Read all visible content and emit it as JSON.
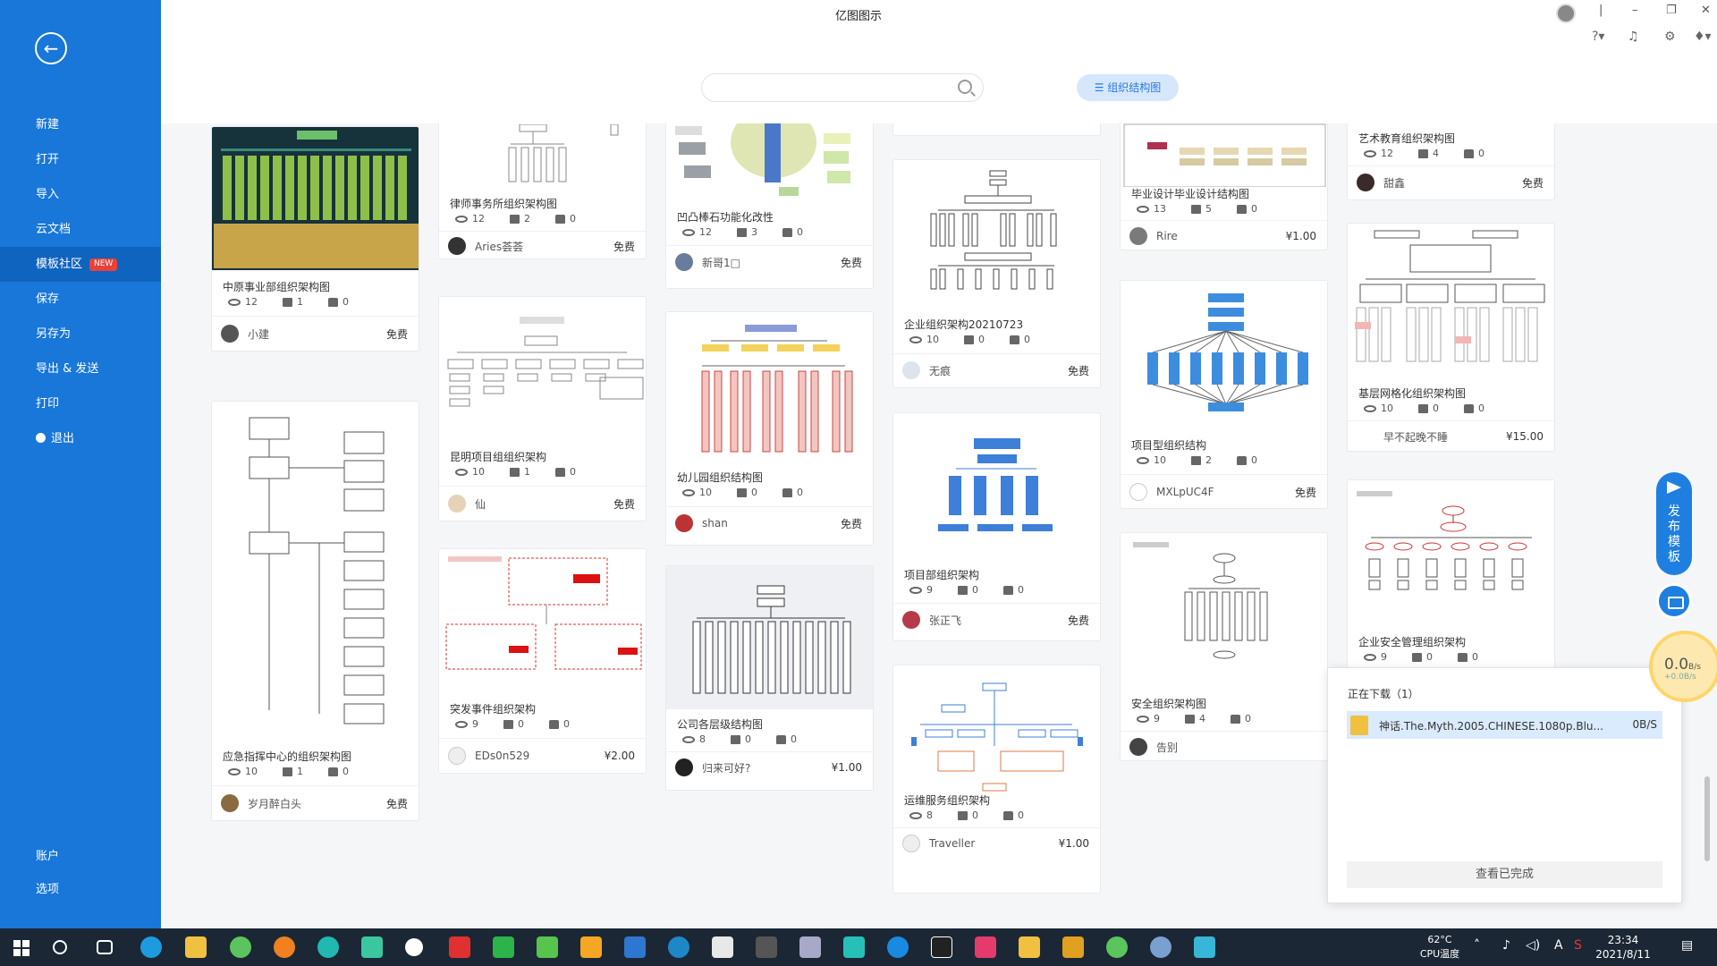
{
  "app": {
    "title": "亿图图示"
  },
  "sidebar": {
    "items": [
      {
        "label": "新建"
      },
      {
        "label": "打开"
      },
      {
        "label": "导入"
      },
      {
        "label": "云文档"
      },
      {
        "label": "模板社区",
        "badge": "NEW",
        "active": true
      },
      {
        "label": "保存"
      },
      {
        "label": "另存为"
      },
      {
        "label": "导出 & 发送"
      },
      {
        "label": "打印"
      },
      {
        "label": "退出"
      }
    ],
    "bottom": [
      {
        "label": "账户"
      },
      {
        "label": "选项"
      }
    ]
  },
  "search": {
    "placeholder": "",
    "filter_label": "☰ 组织结构图"
  },
  "cards": [
    {
      "title": "中原事业部组织架构图",
      "views": "12",
      "comments": "1",
      "likes": "0",
      "author": "小建",
      "price": "免费"
    },
    {
      "title": "应急指挥中心的组织架构图",
      "views": "10",
      "comments": "1",
      "likes": "0",
      "author": "岁月醉白头",
      "price": "免费"
    },
    {
      "title": "律师事务所组织架构图",
      "views": "12",
      "comments": "2",
      "likes": "0",
      "author": "Aries荟荟",
      "price": "免费"
    },
    {
      "title": "昆明项目组组织架构",
      "views": "10",
      "comments": "1",
      "likes": "0",
      "author": "仙",
      "price": "免费"
    },
    {
      "title": "突发事件组织架构",
      "views": "9",
      "comments": "0",
      "likes": "0",
      "author": "EDs0n529",
      "price": "¥2.00"
    },
    {
      "title": "凹凸棒石功能化改性",
      "views": "12",
      "comments": "3",
      "likes": "0",
      "author": "新哥1□",
      "price": "免费"
    },
    {
      "title": "幼儿园组织结构图",
      "views": "10",
      "comments": "0",
      "likes": "0",
      "author": "shan",
      "price": "免费"
    },
    {
      "title": "公司各层级结构图",
      "views": "8",
      "comments": "0",
      "likes": "0",
      "author": "归来可好?",
      "price": "¥1.00"
    },
    {
      "title": "企业组织架构20210723",
      "views": "10",
      "comments": "0",
      "likes": "0",
      "author": "无痕",
      "price": "免费"
    },
    {
      "title": "项目部组织架构",
      "views": "9",
      "comments": "0",
      "likes": "0",
      "author": "张正飞",
      "price": "免费"
    },
    {
      "title": "运维服务组织架构",
      "views": "8",
      "comments": "0",
      "likes": "0",
      "author": "Traveller",
      "price": "¥1.00"
    },
    {
      "title": "毕业设计毕业设计结构图",
      "views": "13",
      "comments": "5",
      "likes": "0",
      "author": "Rire",
      "price": "¥1.00"
    },
    {
      "title": "项目型组织结构",
      "views": "10",
      "comments": "2",
      "likes": "0",
      "author": "MXLpUC4F",
      "price": "免费"
    },
    {
      "title": "安全组织架构图",
      "views": "9",
      "comments": "4",
      "likes": "0",
      "author": "告别",
      "price": ""
    },
    {
      "title": "艺术教育组织架构图",
      "views": "12",
      "comments": "4",
      "likes": "0",
      "author": "甜鑫",
      "price": "免费"
    },
    {
      "title": "基层网格化组织架构图",
      "views": "10",
      "comments": "0",
      "likes": "0",
      "author": "早不起晚不睡",
      "price": "¥15.00"
    },
    {
      "title": "企业安全管理组织架构",
      "views": "9",
      "comments": "0",
      "likes": "0",
      "author": "",
      "price": ""
    }
  ],
  "float": {
    "publish_label": "发布模板"
  },
  "speed": {
    "value": "0.0",
    "unit": "B/s",
    "sub": "+0.0B/s"
  },
  "download": {
    "title": "正在下载（1）",
    "file_name": "神话.The.Myth.2005.CHINESE.1080p.Blu...",
    "speed": "0B/S",
    "view_done": "查看已完成"
  },
  "taskbar": {
    "temp": "62°C",
    "temp_label": "CPU温度",
    "time": "23:34",
    "date": "2021/8/11"
  },
  "colors": {
    "sidebar": "#1877d9",
    "accent": "#2a7ae2"
  }
}
